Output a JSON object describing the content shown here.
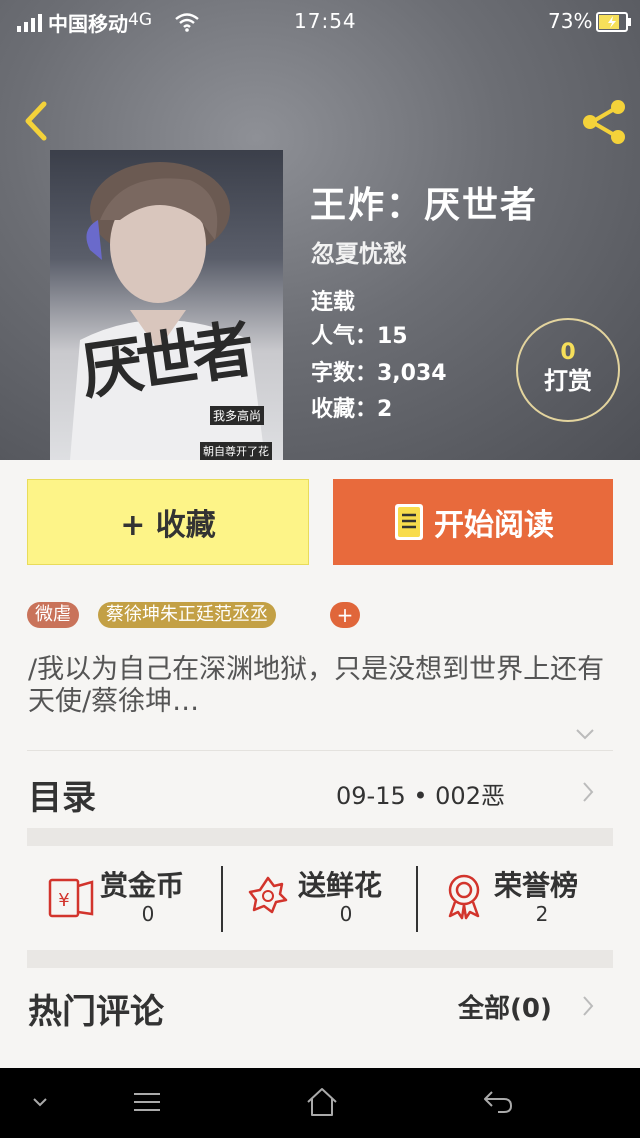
{
  "status_bar": {
    "carrier": "中国移动",
    "network": "4G",
    "time": "17:54",
    "battery": "73%"
  },
  "book": {
    "title": "王炸：厌世者",
    "author": "忽夏忧愁",
    "status": "连载",
    "popularity": "人气：15",
    "word_count": "字数：3,034",
    "favorites": "收藏：2",
    "cover_texts": {
      "title_art": "厌世者",
      "sub1": "我多高尚",
      "sub2": "朝自尊开了花"
    }
  },
  "tip": {
    "count": "0",
    "label": "打赏"
  },
  "actions": {
    "favorite_label": "+ 收藏",
    "read_label": "开始阅读"
  },
  "tags": [
    {
      "label": "微虐",
      "color": "#c9735a"
    },
    {
      "label": "蔡徐坤朱正廷范丞丞",
      "color": "#c3a045"
    }
  ],
  "synopsis": "/我以为自己在深渊地狱，只是没想到世界上还有天使/蔡徐坤…",
  "toc": {
    "label": "目录",
    "latest": "09-15 • 002恶"
  },
  "stats": [
    {
      "label": "赏金币",
      "value": "0",
      "icon": "red-packet-icon"
    },
    {
      "label": "送鲜花",
      "value": "0",
      "icon": "flower-icon"
    },
    {
      "label": "荣誉榜",
      "value": "2",
      "icon": "medal-icon"
    }
  ],
  "comments": {
    "label": "热门评论",
    "all": "全部(0)"
  },
  "colors": {
    "accent_orange": "#e86a3c",
    "accent_yellow": "#fdf488",
    "icon_red": "#d2342c",
    "back_yellow": "#f4d23a"
  }
}
